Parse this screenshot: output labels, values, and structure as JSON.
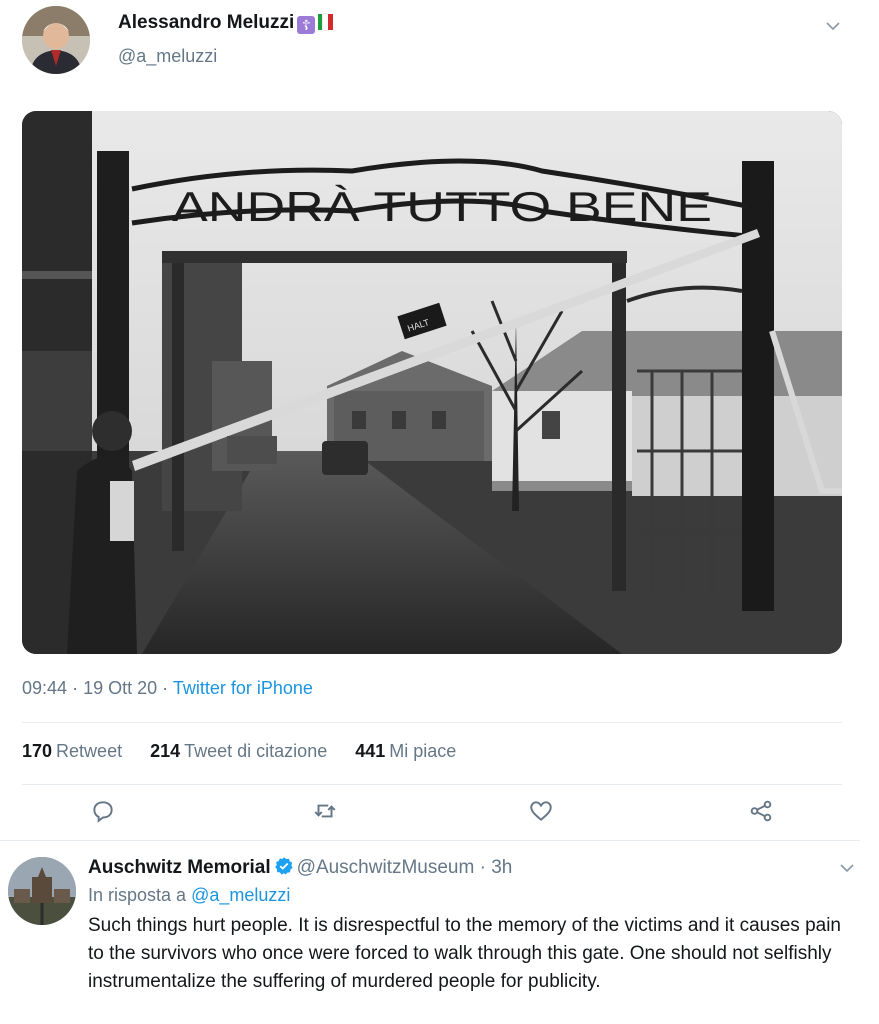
{
  "tweet": {
    "author": {
      "name": "Alessandro Meluzzi",
      "handle": "@a_meluzzi",
      "badge_icon": "orthodox-cross-icon",
      "flag_icon": "italy-flag-icon"
    },
    "image": {
      "sign_text": "ANDRÀ TUTTO BENE",
      "small_sign_text": "HALT"
    },
    "time": "09:44",
    "date": "19 Ott 20",
    "source": "Twitter for iPhone",
    "separator": "·",
    "stats": {
      "retweets_count": "170",
      "retweets_label": "Retweet",
      "quotes_count": "214",
      "quotes_label": "Tweet di citazione",
      "likes_count": "441",
      "likes_label": "Mi piace"
    },
    "actions": [
      "reply-icon",
      "retweet-icon",
      "like-icon",
      "share-icon"
    ]
  },
  "reply": {
    "author": {
      "name": "Auschwitz Memorial",
      "handle": "@AuschwitzMuseum",
      "time": "3h",
      "verified": true
    },
    "in_reply_prefix": "In risposta a",
    "in_reply_handle": "@a_meluzzi",
    "text": "Such things hurt people. It is disrespectful to the memory of the victims and it causes pain to the survivors who once were forced to walk through this gate. One should not selfishly instrumentalize the suffering of murdered people for publicity."
  },
  "colors": {
    "link": "#1b95e0",
    "secondary": "#657786",
    "verified": "#1da1f2",
    "divider": "#e6ecf0"
  }
}
